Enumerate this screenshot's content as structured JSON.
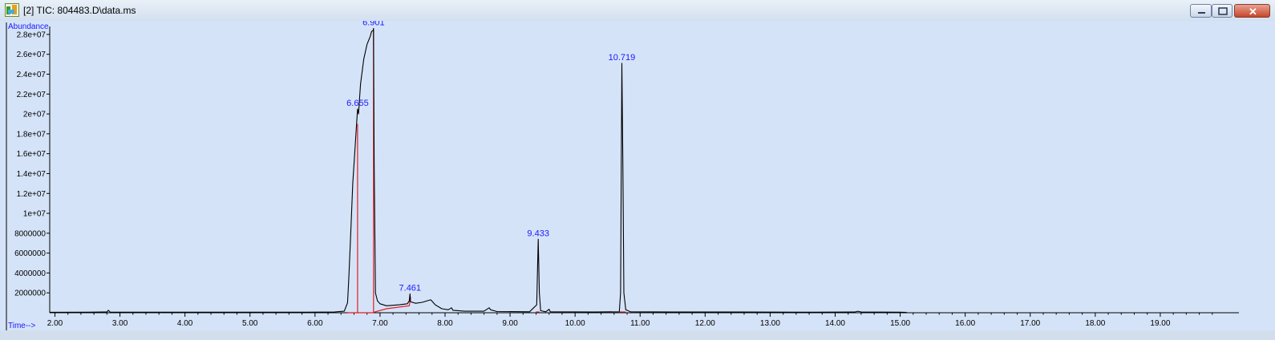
{
  "window": {
    "title": "[2] TIC: 804483.D\\data.ms",
    "icons": {
      "app": "chromatogram-app-icon",
      "minimize": "minimize-icon",
      "maximize": "maximize-icon",
      "close": "close-icon"
    }
  },
  "colors": {
    "plot_bg": "#d5e3f8",
    "trace": "#000000",
    "baseline": "#e02020",
    "peak_label": "#1a1aff",
    "axis_text": "#000000"
  },
  "chart_data": {
    "type": "line",
    "title": "",
    "xlabel": "Time-->",
    "ylabel": "Abundance",
    "xlim": [
      1.92,
      20.0
    ],
    "ylim": [
      0,
      28800000
    ],
    "x_ticks": [
      2.0,
      3.0,
      4.0,
      5.0,
      6.0,
      7.0,
      8.0,
      9.0,
      10.0,
      11.0,
      12.0,
      13.0,
      14.0,
      15.0,
      16.0,
      17.0,
      18.0,
      19.0
    ],
    "x_tick_labels": [
      "2.00",
      "3.00",
      "4.00",
      "5.00",
      "6.00",
      "7.00",
      "8.00",
      "9.00",
      "10.00",
      "11.00",
      "12.00",
      "13.00",
      "14.00",
      "15.00",
      "16.00",
      "17.00",
      "18.00",
      "19.00"
    ],
    "y_ticks": [
      2000000,
      4000000,
      6000000,
      8000000,
      10000000,
      12000000,
      14000000,
      16000000,
      18000000,
      20000000,
      22000000,
      24000000,
      26000000,
      28000000
    ],
    "y_tick_labels": [
      "2000000",
      "4000000",
      "6000000",
      "8000000",
      "1e+07",
      "1.2e+07",
      "1.4e+07",
      "1.6e+07",
      "1.8e+07",
      "2e+07",
      "2.2e+07",
      "2.4e+07",
      "2.6e+07",
      "2.8e+07"
    ],
    "series": [
      {
        "points": [
          [
            1.92,
            50000
          ],
          [
            2.5,
            60000
          ],
          [
            2.8,
            80000
          ],
          [
            2.82,
            250000
          ],
          [
            2.85,
            60000
          ],
          [
            3.5,
            60000
          ],
          [
            4.2,
            60000
          ],
          [
            5.0,
            60000
          ],
          [
            5.8,
            60000
          ],
          [
            6.3,
            80000
          ],
          [
            6.45,
            150000
          ],
          [
            6.5,
            1000000
          ],
          [
            6.52,
            3500000
          ],
          [
            6.55,
            8000000
          ],
          [
            6.58,
            13000000
          ],
          [
            6.62,
            17000000
          ],
          [
            6.655,
            20500000
          ],
          [
            6.67,
            20000000
          ],
          [
            6.7,
            23000000
          ],
          [
            6.75,
            25500000
          ],
          [
            6.8,
            27000000
          ],
          [
            6.85,
            27800000
          ],
          [
            6.87,
            28300000
          ],
          [
            6.895,
            28400000
          ],
          [
            6.9,
            28600000
          ],
          [
            6.91,
            15000000
          ],
          [
            6.93,
            2000000
          ],
          [
            6.96,
            1200000
          ],
          [
            7.0,
            900000
          ],
          [
            7.1,
            700000
          ],
          [
            7.2,
            750000
          ],
          [
            7.3,
            800000
          ],
          [
            7.42,
            900000
          ],
          [
            7.45,
            1200000
          ],
          [
            7.461,
            1900000
          ],
          [
            7.47,
            1100000
          ],
          [
            7.55,
            950000
          ],
          [
            7.65,
            1050000
          ],
          [
            7.75,
            1250000
          ],
          [
            7.78,
            1300000
          ],
          [
            7.85,
            800000
          ],
          [
            7.95,
            400000
          ],
          [
            8.05,
            300000
          ],
          [
            8.1,
            500000
          ],
          [
            8.12,
            250000
          ],
          [
            8.3,
            150000
          ],
          [
            8.6,
            150000
          ],
          [
            8.68,
            500000
          ],
          [
            8.7,
            300000
          ],
          [
            8.8,
            120000
          ],
          [
            9.3,
            100000
          ],
          [
            9.41,
            800000
          ],
          [
            9.433,
            7400000
          ],
          [
            9.45,
            2000000
          ],
          [
            9.47,
            200000
          ],
          [
            9.55,
            100000
          ],
          [
            9.6,
            350000
          ],
          [
            9.62,
            100000
          ],
          [
            10.3,
            80000
          ],
          [
            10.68,
            100000
          ],
          [
            10.7,
            2000000
          ],
          [
            10.719,
            25100000
          ],
          [
            10.735,
            14500000
          ],
          [
            10.75,
            2000000
          ],
          [
            10.78,
            300000
          ],
          [
            10.85,
            100000
          ],
          [
            11.5,
            80000
          ],
          [
            12.5,
            70000
          ],
          [
            13.5,
            60000
          ],
          [
            14.3,
            70000
          ],
          [
            14.35,
            150000
          ],
          [
            14.4,
            80000
          ],
          [
            15.0,
            60000
          ],
          [
            15.1,
            40000
          ]
        ]
      }
    ],
    "integration_baselines": [
      {
        "points": [
          [
            6.5,
            0
          ],
          [
            6.655,
            0
          ],
          [
            6.655,
            19000000
          ]
        ]
      },
      {
        "points": [
          [
            6.655,
            0
          ],
          [
            6.9,
            0
          ],
          [
            6.9,
            28600000
          ]
        ]
      },
      {
        "points": [
          [
            6.9,
            50000
          ],
          [
            7.1,
            400000
          ],
          [
            7.45,
            700000
          ],
          [
            7.47,
            1600000
          ]
        ]
      },
      {
        "points": [
          [
            9.4,
            80000
          ],
          [
            9.45,
            80000
          ]
        ]
      },
      {
        "points": [
          [
            10.69,
            80000
          ],
          [
            10.78,
            80000
          ]
        ]
      }
    ],
    "peak_labels": [
      {
        "x": 6.655,
        "y": 20500000,
        "label": "6.655"
      },
      {
        "x": 6.901,
        "y": 28600000,
        "label": "6.901"
      },
      {
        "x": 7.461,
        "y": 1900000,
        "label": "7.461"
      },
      {
        "x": 9.433,
        "y": 7400000,
        "label": "9.433"
      },
      {
        "x": 10.719,
        "y": 25100000,
        "label": "10.719"
      }
    ],
    "grid": false
  }
}
